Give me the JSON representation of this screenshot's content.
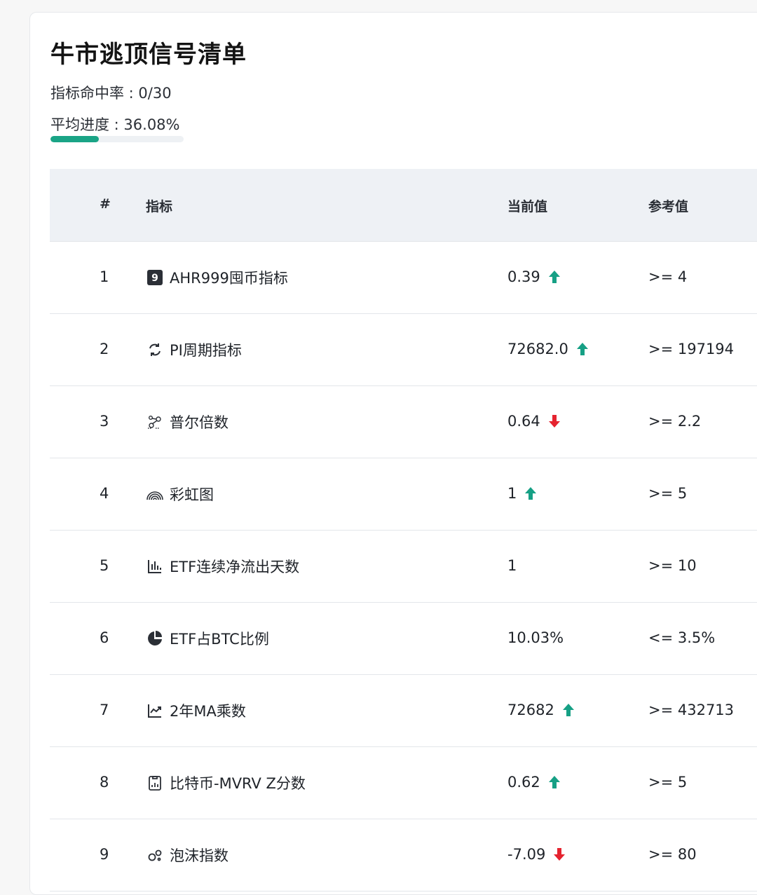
{
  "title": "牛市逃顶信号清单",
  "hit_rate": "指标命中率 : 0/30",
  "avg_progress": {
    "label": "平均进度 : 36.08%",
    "value": 0.3608
  },
  "colors": {
    "up": "#16a085",
    "down": "#e5232f",
    "accent": "#1aa486"
  },
  "table": {
    "headers": [
      "#",
      "指标",
      "当前值",
      "参考值"
    ],
    "rows": [
      {
        "num": "1",
        "icon": "nine-badge-icon",
        "icon_text": "9",
        "name": "AHR999囤币指标",
        "current": "0.39",
        "trend": "up",
        "reference": ">= 4"
      },
      {
        "num": "2",
        "icon": "cycle-arrows-icon",
        "name": "PI周期指标",
        "current": "72682.0",
        "trend": "up",
        "reference": ">= 197194"
      },
      {
        "num": "3",
        "icon": "molecule-icon",
        "name": "普尔倍数",
        "current": "0.64",
        "trend": "down",
        "reference": ">= 2.2"
      },
      {
        "num": "4",
        "icon": "rainbow-icon",
        "name": "彩虹图",
        "current": "1",
        "trend": "up",
        "reference": ">= 5"
      },
      {
        "num": "5",
        "icon": "bar-chart-icon",
        "name": "ETF连续净流出天数",
        "current": "1",
        "trend": "none",
        "reference": ">= 10"
      },
      {
        "num": "6",
        "icon": "pie-chart-icon",
        "name": "ETF占BTC比例",
        "current": "10.03%",
        "trend": "none",
        "reference": "<= 3.5%"
      },
      {
        "num": "7",
        "icon": "line-chart-icon",
        "name": "2年MA乘数",
        "current": "72682",
        "trend": "up",
        "reference": ">= 432713"
      },
      {
        "num": "8",
        "icon": "clipboard-chart-icon",
        "name": "比特币-MVRV Z分数",
        "current": "0.62",
        "trend": "up",
        "reference": ">= 5"
      },
      {
        "num": "9",
        "icon": "bubbles-icon",
        "name": "泡沫指数",
        "current": "-7.09",
        "trend": "down",
        "reference": ">= 80"
      }
    ]
  }
}
